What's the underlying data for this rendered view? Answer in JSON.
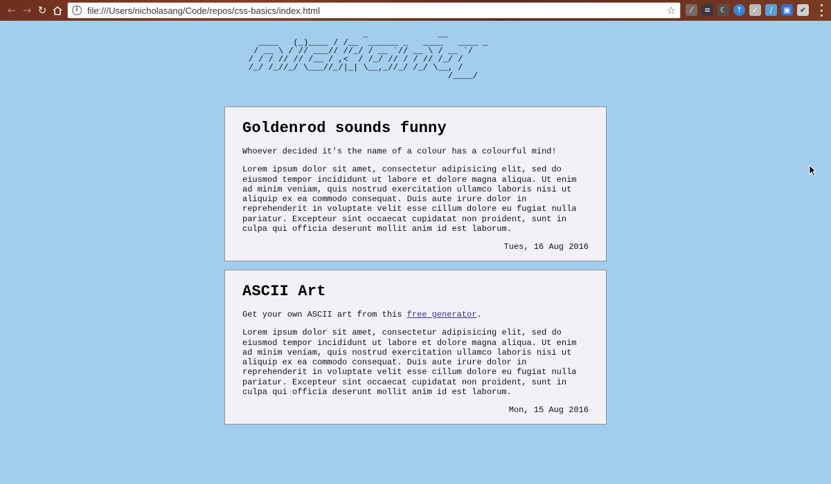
{
  "browser": {
    "url": "file:///Users/nicholasang/Code/repos/css-basics/index.html",
    "back_icon": "arrow-left",
    "forward_icon": "arrow-right",
    "reload_icon": "reload",
    "home_icon": "home",
    "extensions": [
      {
        "name": "eyedropper",
        "color": "#7a6a66"
      },
      {
        "name": "layers",
        "color": "#3a3a3a"
      },
      {
        "name": "moon",
        "color": "#55514e"
      },
      {
        "name": "arrow-badge",
        "color": "#3b84d9"
      },
      {
        "name": "pocket",
        "color": "#b9b9b9"
      },
      {
        "name": "feather",
        "color": "#5aa0d6"
      },
      {
        "name": "window",
        "color": "#2f6fcc"
      },
      {
        "name": "checklist",
        "color": "#cfcfcf"
      }
    ]
  },
  "logo": {
    "ascii": "                       _              __                           \n  ____   (_)____ / /__  ______ _   ____   ____ _\n / __ \\ / // ___// //_/ / __ `// __ \\ / __ `/\n/ / / // // /__ / ,<  / /_/ // / / // /_/ / \n/_/ /_//_/ \\___//_/|_| \\__,_//_/ /_/ \\__, /  \n                                        /____/   "
  },
  "posts": [
    {
      "title": "Goldenrod sounds funny",
      "intro": "Whoever decided it's the name of a colour has a colourful mind!",
      "body": "Lorem ipsum dolor sit amet, consectetur adipisicing elit, sed do eiusmod tempor incididunt ut labore et dolore magna aliqua. Ut enim ad minim veniam, quis nostrud exercitation ullamco laboris nisi ut aliquip ex ea commodo consequat. Duis aute irure dolor in reprehenderit in voluptate velit esse cillum dolore eu fugiat nulla pariatur. Excepteur sint occaecat cupidatat non proident, sunt in culpa qui officia deserunt mollit anim id est laborum.",
      "date": "Tues, 16 Aug 2016"
    },
    {
      "title": "ASCII Art",
      "intro_prefix": "Get your own ASCII art from this ",
      "intro_link": "free generator",
      "intro_suffix": ".",
      "body": "Lorem ipsum dolor sit amet, consectetur adipisicing elit, sed do eiusmod tempor incididunt ut labore et dolore magna aliqua. Ut enim ad minim veniam, quis nostrud exercitation ullamco laboris nisi ut aliquip ex ea commodo consequat. Duis aute irure dolor in reprehenderit in voluptate velit esse cillum dolore eu fugiat nulla pariatur. Excepteur sint occaecat cupidatat non proident, sunt in culpa qui officia deserunt mollit anim id est laborum.",
      "date": "Mon, 15 Aug 2016"
    }
  ],
  "colors": {
    "page_background": "#a3cdec",
    "card_background": "#f2f2f6",
    "link": "#3c2a8c"
  }
}
